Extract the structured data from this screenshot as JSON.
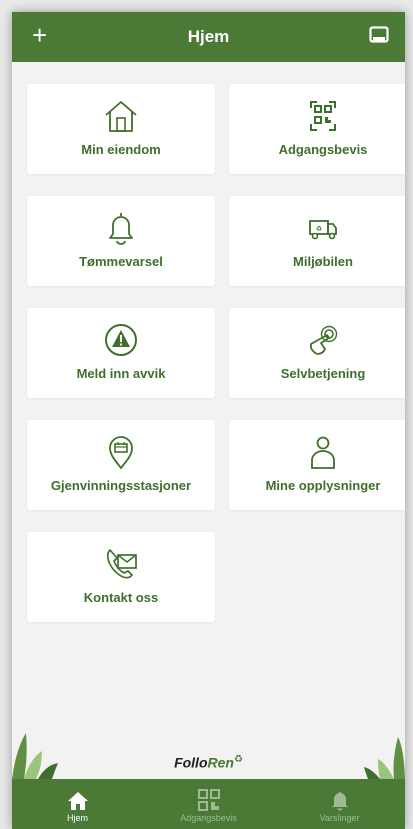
{
  "header": {
    "title": "Hjem"
  },
  "tiles": [
    {
      "label": "Min eiendom",
      "icon": "house-icon"
    },
    {
      "label": "Adgangsbevis",
      "icon": "qr-code-icon"
    },
    {
      "label": "Tømmevarsel",
      "icon": "bell-icon"
    },
    {
      "label": "Miljøbilen",
      "icon": "truck-icon"
    },
    {
      "label": "Meld inn avvik",
      "icon": "warning-icon"
    },
    {
      "label": "Selvbetjening",
      "icon": "touch-icon"
    },
    {
      "label": "Gjenvinningsstasjoner",
      "icon": "location-pin-icon"
    },
    {
      "label": "Mine opplysninger",
      "icon": "person-icon"
    },
    {
      "label": "Kontakt oss",
      "icon": "phone-mail-icon"
    }
  ],
  "logo": {
    "part1": "Follo",
    "part2": "Ren",
    "mark": "♻"
  },
  "tabs": [
    {
      "label": "Hjem",
      "icon": "home-icon",
      "active": true
    },
    {
      "label": "Adgangsbevis",
      "icon": "qr-code-icon",
      "active": false
    },
    {
      "label": "Varslinger",
      "icon": "bell-icon",
      "active": false
    }
  ],
  "colors": {
    "brand": "#4a7a36",
    "label": "#3f6f2c",
    "background": "#f2f2f2"
  }
}
